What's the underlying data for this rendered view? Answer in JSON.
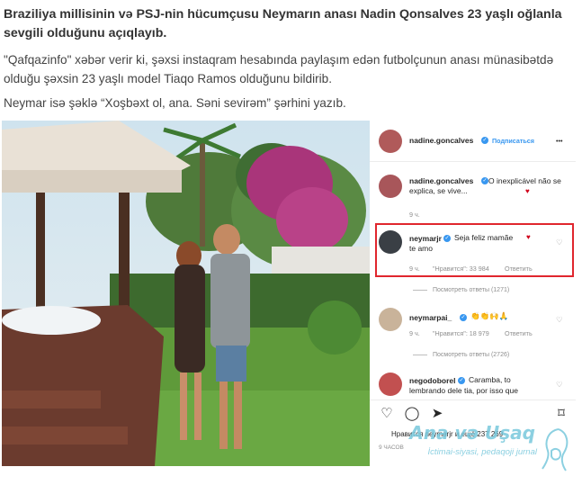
{
  "article": {
    "headline": "Braziliya millisinin və PSJ-nin hücumçusu Neymarın anası Nadin Qonsalves 23 yaşlı oğlanla sevgili olduğunu açıqlayıb.",
    "paragraph1": "\"Qafqazinfo\" xəbər verir ki, şəxsi instaqram hesabında paylaşım edən futbolçunun anası münasibətdə olduğu şəxsin 23 yaşlı model Tiaqo Ramos olduğunu bildirib.",
    "paragraph2": "Neymar isə şəklə “Xoşbəxt ol, ana. Səni sevirəm” şərhini yazıb."
  },
  "instagram": {
    "header": {
      "username": "nadine.goncalves",
      "follow": "Подписаться",
      "more": "•••"
    },
    "caption": {
      "username": "nadine.goncalves",
      "text": "O inexplicável não se explica, se vive...",
      "time": "9 ч."
    },
    "comments": [
      {
        "username": "neymarjr",
        "text_line1": "Seja feliz mamãe",
        "text_line2": "te amo",
        "time": "9 ч.",
        "likes": "\"Нравится\": 33 984",
        "reply": "Ответить",
        "replies": "Посмотреть ответы (1271)"
      },
      {
        "username": "neymarpai_",
        "time": "9 ч.",
        "likes": "\"Нравится\": 18 979",
        "reply": "Ответить",
        "replies": "Посмотреть ответы (2726)"
      },
      {
        "username": "negodoborel",
        "text_line1": "Caramba, to",
        "text_line2": "lembrando dele tia, por isso que"
      }
    ],
    "likes_line": "Нравится neymarjr и ещё 237 269",
    "date_line": "9 ЧАСОВ"
  },
  "watermark": {
    "title": "Ana və Uşaq",
    "subtitle": "İctimai-siyasi, pedaqoji jurnal"
  },
  "colors": {
    "highlight_box": "#e0262e",
    "verified": "#3897f0",
    "watermark": "#78c8dc"
  }
}
